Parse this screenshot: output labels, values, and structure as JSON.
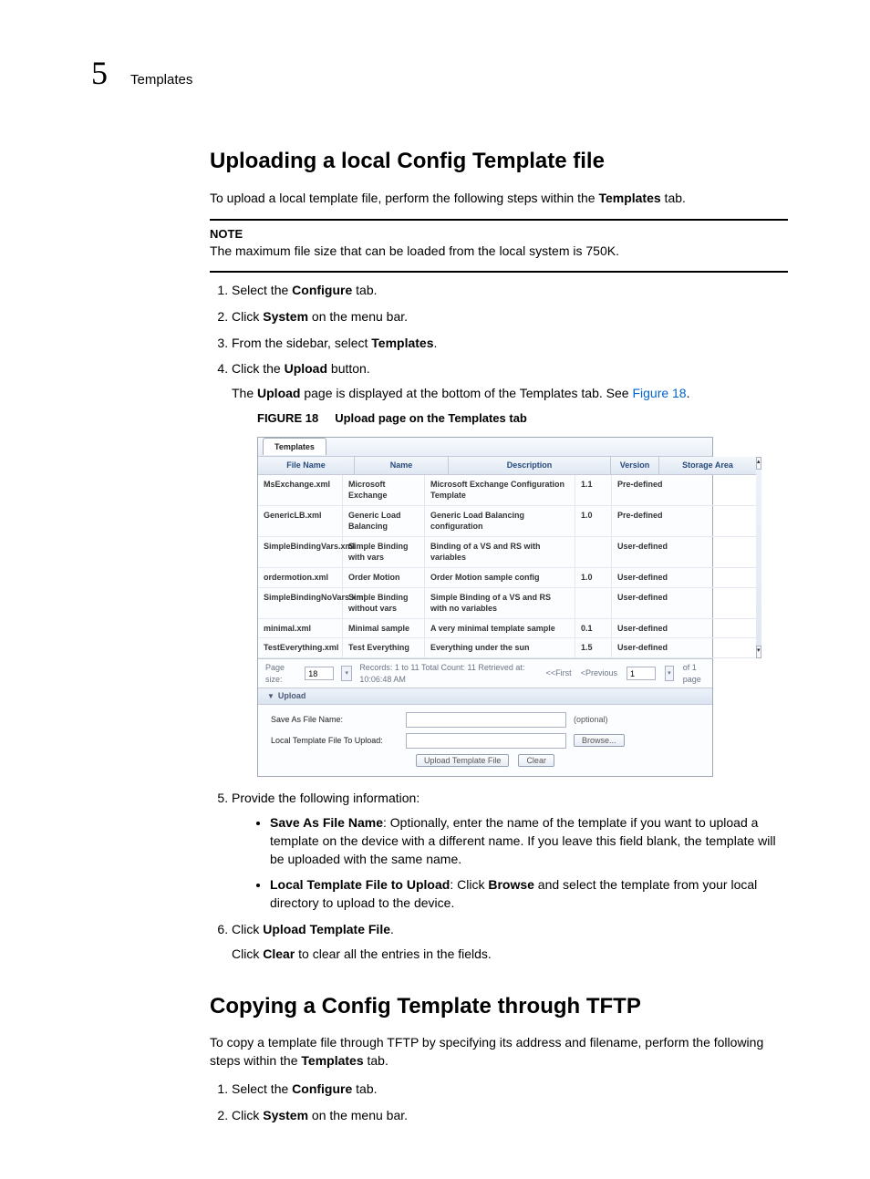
{
  "header": {
    "chapter_number": "5",
    "chapter_title": "Templates"
  },
  "section1": {
    "heading": "Uploading a local Config Template file",
    "intro_parts": [
      "To upload a local template file, perform the following steps within the ",
      "Templates",
      " tab."
    ],
    "note_label": "NOTE",
    "note_text": "The maximum file size that can be loaded from the local system is 750K.",
    "steps": {
      "s1": [
        "Select the ",
        "Configure",
        " tab."
      ],
      "s2": [
        "Click ",
        "System",
        " on the menu bar."
      ],
      "s3": [
        "From the sidebar, select ",
        "Templates",
        "."
      ],
      "s4_line1": [
        "Click the ",
        "Upload",
        " button."
      ],
      "s4_line2_parts": [
        "The ",
        "Upload",
        " page is displayed at the bottom of the Templates tab. See ",
        "Figure 18",
        "."
      ],
      "s5_line1": "Provide the following information:",
      "s5_b1": [
        "Save As File Name",
        ": Optionally, enter the name of the template if you want to upload a template on the device with a different name. If you leave this field blank, the template will be uploaded with the same name."
      ],
      "s5_b2": [
        "Local Template File to Upload",
        ": Click ",
        "Browse",
        " and select the template from your local directory to upload to the device."
      ],
      "s6_line1": [
        "Click ",
        "Upload Template File",
        "."
      ],
      "s6_line2": [
        "Click ",
        "Clear",
        " to clear all the entries in the fields."
      ]
    },
    "figure": {
      "label": "FIGURE 18",
      "title": "Upload page on the Templates tab"
    }
  },
  "screenshot": {
    "tab": "Templates",
    "columns": {
      "file": "File Name",
      "name": "Name",
      "desc": "Description",
      "ver": "Version",
      "stor": "Storage Area"
    },
    "rows": [
      {
        "file": "MsExchange.xml",
        "name": "Microsoft Exchange",
        "desc": "Microsoft Exchange Configuration Template",
        "ver": "1.1",
        "stor": "Pre-defined"
      },
      {
        "file": "GenericLB.xml",
        "name": "Generic Load Balancing",
        "desc": "Generic Load Balancing configuration",
        "ver": "1.0",
        "stor": "Pre-defined"
      },
      {
        "file": "SimpleBindingVars.xml",
        "name": "Simple Binding with vars",
        "desc": "Binding of a VS and RS with variables",
        "ver": "",
        "stor": "User-defined"
      },
      {
        "file": "ordermotion.xml",
        "name": "Order Motion",
        "desc": "Order Motion sample config",
        "ver": "1.0",
        "stor": "User-defined"
      },
      {
        "file": "SimpleBindingNoVars.xml",
        "name": "Simple Binding without vars",
        "desc": "Simple Binding of a VS and RS with no variables",
        "ver": "",
        "stor": "User-defined"
      },
      {
        "file": "minimal.xml",
        "name": "Minimal sample",
        "desc": "A very minimal template sample",
        "ver": "0.1",
        "stor": "User-defined"
      },
      {
        "file": "TestEverything.xml",
        "name": "Test Everything",
        "desc": "Everything under the sun",
        "ver": "1.5",
        "stor": "User-defined"
      }
    ],
    "pager": {
      "page_size_label": "Page size:",
      "page_size_value": "18",
      "records_text": "Records: 1 to 11 Total Count: 11  Retrieved at: 10:06:48 AM",
      "first": "<<First",
      "prev": "<Previous",
      "page_num": "1",
      "of_pages": "of 1 page"
    },
    "upload_section": {
      "title": "Upload",
      "save_as_label": "Save As File Name:",
      "optional": "(optional)",
      "local_file_label": "Local Template File To Upload:",
      "browse_btn": "Browse...",
      "upload_btn": "Upload Template File",
      "clear_btn": "Clear"
    }
  },
  "section2": {
    "heading": "Copying a Config Template through TFTP",
    "intro_parts": [
      "To copy a template file through TFTP by specifying its address and filename, perform the following steps within the ",
      "Templates",
      " tab."
    ],
    "steps": {
      "s1": [
        "Select the ",
        "Configure",
        " tab."
      ],
      "s2": [
        "Click ",
        "System",
        " on the menu bar."
      ]
    }
  }
}
